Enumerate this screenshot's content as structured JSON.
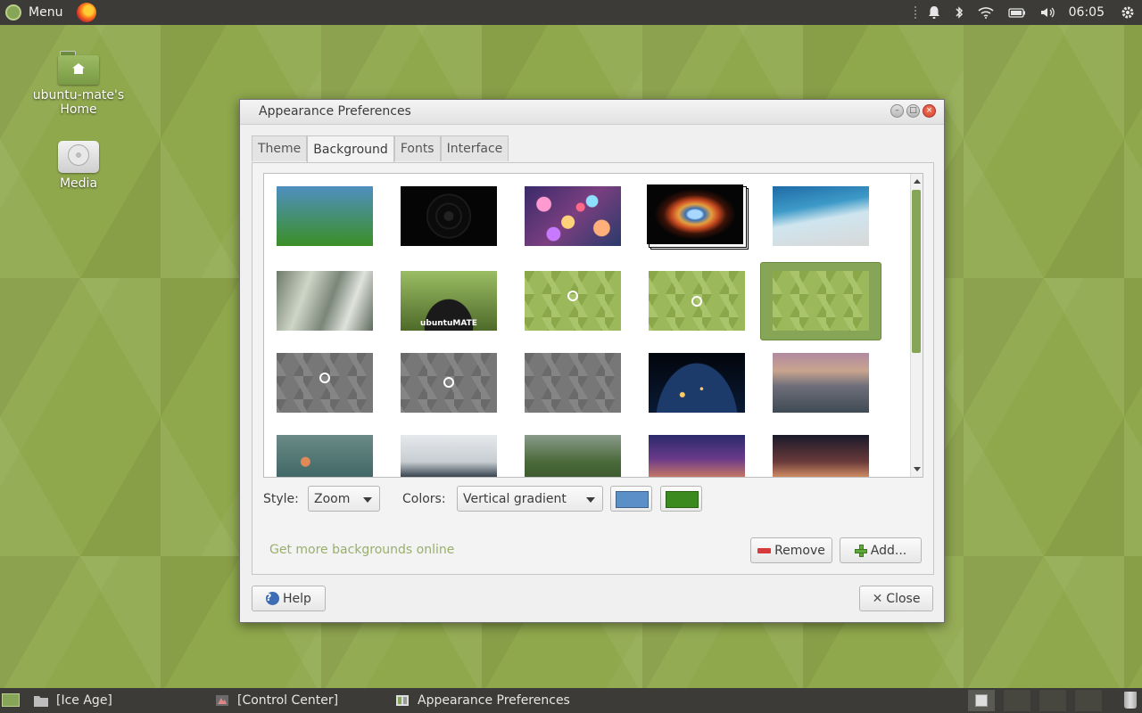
{
  "top_panel": {
    "menu_label": "Menu",
    "clock": "06:05",
    "tray_icons": [
      "notification-bell-icon",
      "bluetooth-icon",
      "wifi-icon",
      "battery-icon",
      "volume-icon",
      "system-gear-icon"
    ]
  },
  "desktop": {
    "icons": [
      {
        "label": "ubuntu-mate's Home",
        "icon": "home-folder-icon"
      },
      {
        "label": "Media",
        "icon": "drive-icon"
      }
    ]
  },
  "window": {
    "title": "Appearance Preferences",
    "tabs": [
      {
        "label": "Theme",
        "active": false
      },
      {
        "label": "Background",
        "active": true
      },
      {
        "label": "Fonts",
        "active": false
      },
      {
        "label": "Interface",
        "active": false
      }
    ],
    "wallpapers": [
      {
        "name": "vertical-gradient"
      },
      {
        "name": "dark-rings"
      },
      {
        "name": "bokeh-lights"
      },
      {
        "name": "helix-nebula",
        "stacked": true
      },
      {
        "name": "ocean-waves"
      },
      {
        "name": "machine-interior"
      },
      {
        "name": "ubuntu-mate-hill"
      },
      {
        "name": "green-hex-mate-logo"
      },
      {
        "name": "green-hex-circle-logo"
      },
      {
        "name": "green-hex-plain",
        "selected": true
      },
      {
        "name": "grey-hex-mate-logo"
      },
      {
        "name": "grey-hex-circle-logo"
      },
      {
        "name": "grey-hex-plain"
      },
      {
        "name": "earth-night-lights"
      },
      {
        "name": "mountain-sunset"
      },
      {
        "name": "rain-window"
      },
      {
        "name": "misty-mountain"
      },
      {
        "name": "green-cliffs"
      },
      {
        "name": "milky-way"
      },
      {
        "name": "dusk-silhouette"
      }
    ],
    "style_label": "Style:",
    "style_value": "Zoom",
    "colors_label": "Colors:",
    "colors_value": "Vertical gradient",
    "primary_color": "#5b8fc8",
    "secondary_color": "#3a8a20",
    "link_text": "Get more backgrounds online",
    "remove_label": "Remove",
    "add_label": "Add...",
    "help_label": "Help",
    "close_label": "Close"
  },
  "bottom_panel": {
    "tasks": [
      {
        "label": "[Ice Age]",
        "icon": "folder-icon"
      },
      {
        "label": "[Control Center]",
        "icon": "control-center-icon"
      },
      {
        "label": "Appearance Preferences",
        "icon": "appearance-icon"
      }
    ]
  },
  "colors": {
    "panel": "#3c3b37",
    "accent": "#87a556",
    "selection": "#87a556"
  }
}
